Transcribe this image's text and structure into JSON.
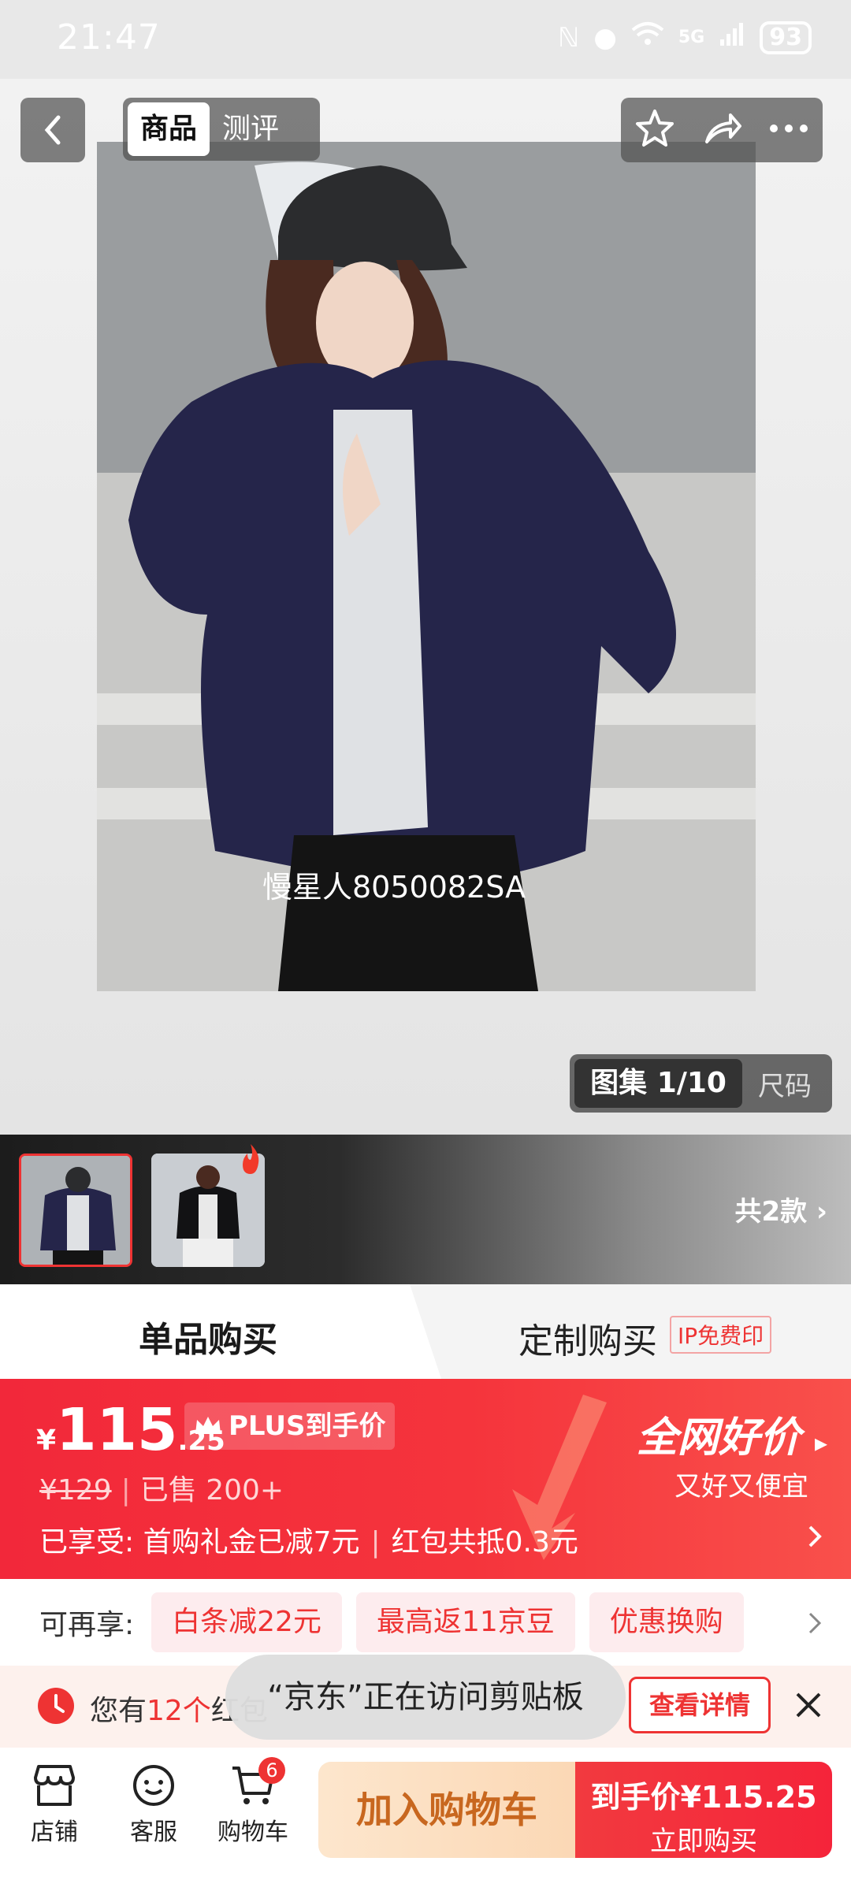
{
  "status_bar": {
    "time": "21:47",
    "network": "5G",
    "battery": "93"
  },
  "nav": {
    "tabs": [
      {
        "label": "商品",
        "active": true
      },
      {
        "label": "测评",
        "active": false
      }
    ]
  },
  "hero": {
    "caption": "慢星人8050082SA",
    "gallery_label": "图集 1/10",
    "size_label": "尺码"
  },
  "variants": {
    "count_label": "共2款"
  },
  "purchase_tabs": {
    "single": "单品购买",
    "custom": "定制购买",
    "custom_badge": "IP免费印"
  },
  "price": {
    "currency": "¥",
    "integer": "115",
    "decimal": ".25",
    "plus_label": "PLUS到手价",
    "original": "¥129",
    "sold": "已售 200+",
    "enjoyed_prefix": "已享受:",
    "enjoyed_gift": "首购礼金已减7元",
    "enjoyed_redpacket": "红包共抵0.3元",
    "best_title": "全网好价",
    "best_sub": "又好又便宜"
  },
  "offers": {
    "label": "可再享:",
    "chips": [
      "白条减22元",
      "最高返11京豆",
      "优惠换购"
    ]
  },
  "notice": {
    "prefix": "您有",
    "count": "12个",
    "suffix": "红包",
    "detail_button": "查看详情"
  },
  "toast": "“京东”正在访问剪贴板",
  "bottom_bar": {
    "store": "店铺",
    "service": "客服",
    "cart": "购物车",
    "cart_count": "6",
    "add_to_cart": "加入购物车",
    "buy_line1": "到手价¥115.25",
    "buy_line2": "立即购买"
  },
  "colors": {
    "brand_red": "#f2283a",
    "accent_orange": "#c8671f"
  }
}
